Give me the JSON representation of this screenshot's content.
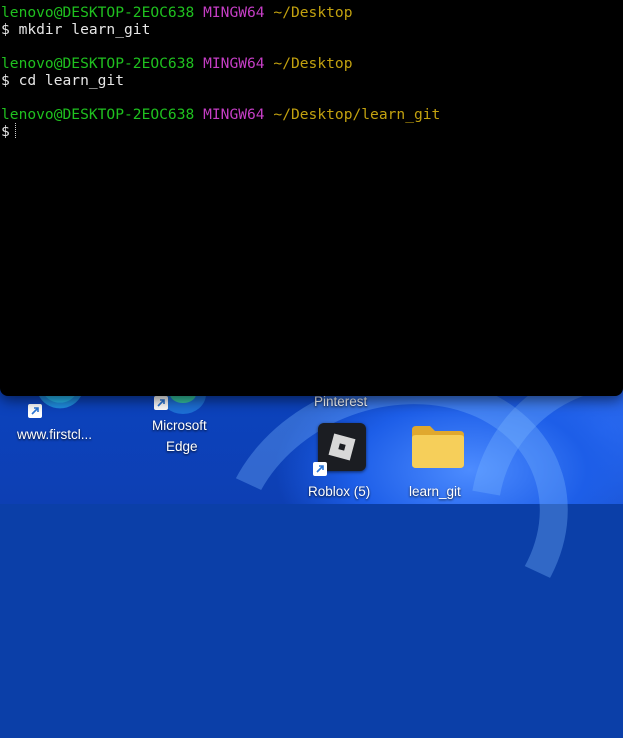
{
  "terminal": {
    "lines": [
      {
        "user": "lenovo@DESKTOP-2EOC638",
        "shell": "MINGW64",
        "path": "~/Desktop"
      },
      {
        "command": "$ mkdir learn_git"
      },
      {
        "user": "lenovo@DESKTOP-2EOC638",
        "shell": "MINGW64",
        "path": "~/Desktop"
      },
      {
        "command": "$ cd learn_git"
      },
      {
        "user": "lenovo@DESKTOP-2EOC638",
        "shell": "MINGW64",
        "path": "~/Desktop/learn_git"
      },
      {
        "command": "$"
      }
    ]
  },
  "desktop": {
    "icons": [
      {
        "label": "www.firstcl..."
      },
      {
        "label_line1": "Microsoft",
        "label_line2": "Edge"
      },
      {
        "label": "Pinterest"
      },
      {
        "label": "Roblox (5)"
      },
      {
        "label": "learn_git"
      }
    ]
  },
  "colors": {
    "prompt_user": "#1fc11f",
    "prompt_shell": "#c53ec5",
    "prompt_path": "#c2a10f",
    "terminal_bg": "#000000",
    "folder": "#f3c84a"
  }
}
